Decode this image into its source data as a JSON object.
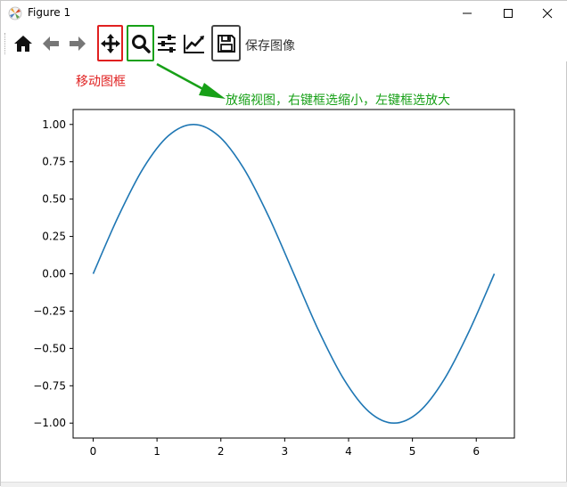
{
  "window": {
    "title": "Figure 1",
    "controls": [
      "minimize",
      "maximize",
      "close"
    ]
  },
  "toolbar": {
    "buttons": [
      {
        "icon": "home-icon",
        "name": "home"
      },
      {
        "icon": "arrow-left-icon",
        "name": "back"
      },
      {
        "icon": "arrow-right-icon",
        "name": "forward"
      },
      {
        "icon": "move-icon",
        "name": "pan",
        "highlight": "#e02020"
      },
      {
        "icon": "magnifier-icon",
        "name": "zoom",
        "highlight": "#17a017"
      },
      {
        "icon": "sliders-icon",
        "name": "subplots"
      },
      {
        "icon": "line-chart-icon",
        "name": "edit"
      },
      {
        "icon": "floppy-disk-icon",
        "name": "save",
        "highlight": "#444444"
      }
    ],
    "save_label": "保存图像"
  },
  "annotations": {
    "pan": "移动图框",
    "zoom": "放缩视图，右键框选缩小，左键框选放大"
  },
  "colors": {
    "pan_highlight": "#e02020",
    "zoom_highlight": "#17a017",
    "line": "#1f77b4"
  },
  "chart_data": {
    "type": "line",
    "title": "",
    "xlabel": "",
    "ylabel": "",
    "xlim": [
      -0.314,
      6.597
    ],
    "ylim": [
      -1.1,
      1.1
    ],
    "xticks": [
      "0",
      "1",
      "2",
      "3",
      "4",
      "5",
      "6"
    ],
    "yticks": [
      "1.00",
      "0.75",
      "0.50",
      "0.25",
      "0.00",
      "−0.25",
      "−0.50",
      "−0.75",
      "−1.00"
    ],
    "series": [
      {
        "x": [
          0.0,
          0.393,
          0.785,
          1.178,
          1.571,
          1.963,
          2.356,
          2.749,
          3.142,
          3.534,
          3.927,
          4.32,
          4.712,
          5.105,
          5.498,
          5.89,
          6.283
        ],
        "y": [
          0.0,
          0.383,
          0.707,
          0.924,
          1.0,
          0.924,
          0.707,
          0.383,
          0.0,
          -0.383,
          -0.707,
          -0.924,
          -1.0,
          -0.924,
          -0.707,
          -0.383,
          0.0
        ]
      }
    ]
  }
}
